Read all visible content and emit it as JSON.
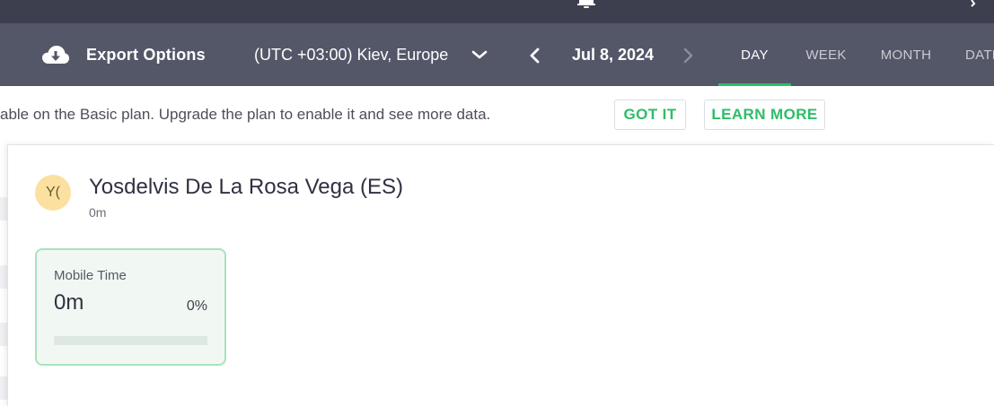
{
  "toolbar": {
    "export_label": "Export Options",
    "timezone": "(UTC +03:00) Kiev, Europe",
    "date": "Jul 8, 2024",
    "tabs": [
      {
        "label": "DAY",
        "active": true
      },
      {
        "label": "WEEK",
        "active": false
      },
      {
        "label": "MONTH",
        "active": false
      },
      {
        "label": "DATE",
        "active": false
      }
    ]
  },
  "banner": {
    "text": "able on the Basic plan. Upgrade the plan to enable it and see more data.",
    "got_it": "GOT IT",
    "learn_more": "LEARN MORE"
  },
  "panel": {
    "avatar_initials": "Y(",
    "user_name": "Yosdelvis De La Rosa Vega (ES)",
    "total_time": "0m",
    "card": {
      "title": "Mobile Time",
      "value": "0m",
      "percent": "0%",
      "progress_fraction": 0
    }
  },
  "colors": {
    "topbar": "#3d3f4e",
    "toolbar": "#545768",
    "accent": "#2ebd68",
    "avatar_bg": "#fbe0a0",
    "card_bg": "#f1f8f3",
    "card_border": "#a8e3bd"
  },
  "icons": {
    "export": "cloud-download-icon",
    "timezone_dropdown": "chevron-down-icon",
    "prev": "chevron-left-icon",
    "next": "chevron-right-icon"
  }
}
